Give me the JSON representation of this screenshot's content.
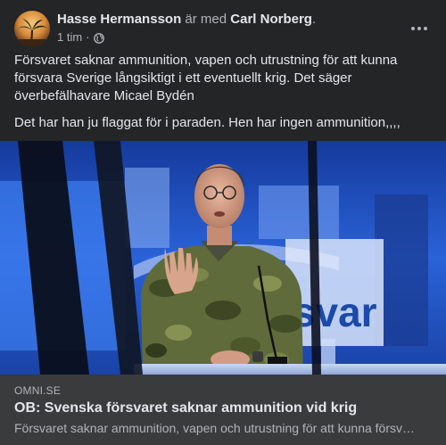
{
  "post": {
    "author": "Hasse Hermansson",
    "with_text": "är med",
    "tagged": "Carl Norberg",
    "tagged_suffix": ".",
    "time": "1 tim",
    "separator": "·",
    "audience_icon": "globe-icon",
    "more_icon": "more-options-icon",
    "text": {
      "paragraph_1": "Försvaret saknar ammunition, vapen och utrustning för att kunna försvara Sverige långsiktigt i ett eventuellt krig. Det säger överbefälhavare Micael Bydén",
      "paragraph_2": "Det har han ju flaggat för i paraden. Hen har ingen ammunition,,,,"
    }
  },
  "image": {
    "background_sign_text": "rsvar"
  },
  "link_card": {
    "domain": "OMNI.SE",
    "title": "OB: Svenska försvaret saknar ammunition vid krig",
    "description": "Försvaret saknar ammunition, vapen och utrustning för att kunna försvara Sverige långsiktigt i ett eventuellt krig. Det säger överbefälhavare Micael Bydén"
  },
  "colors": {
    "background": "#242526",
    "card": "#3a3b3c",
    "primary_text": "#e4e6eb",
    "secondary_text": "#b0b3b8"
  }
}
